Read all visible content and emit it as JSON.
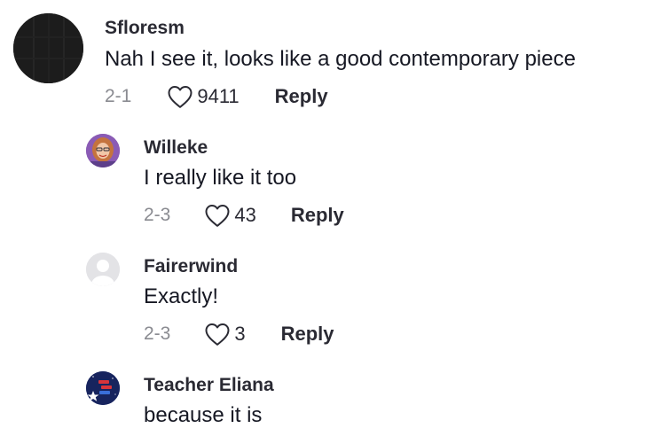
{
  "comments": [
    {
      "username": "Sfloresm",
      "text": "Nah I see it, looks like a good contemporary piece",
      "date": "2-1",
      "likes": "9411",
      "reply_label": "Reply"
    },
    {
      "username": "Willeke",
      "text": "I really like it too",
      "date": "2-3",
      "likes": "43",
      "reply_label": "Reply"
    },
    {
      "username": "Fairerwind",
      "text": "Exactly!",
      "date": "2-3",
      "likes": "3",
      "reply_label": "Reply"
    },
    {
      "username": "Teacher Eliana",
      "text": "because it is"
    }
  ],
  "icons": {
    "like": "heart-outline-icon",
    "default_avatar": "user-silhouette-icon"
  },
  "colors": {
    "text_primary": "#161823",
    "text_secondary": "#8a8b91",
    "avatar_dark": "#1c1c1c",
    "avatar_default_bg": "#e3e3e6"
  }
}
